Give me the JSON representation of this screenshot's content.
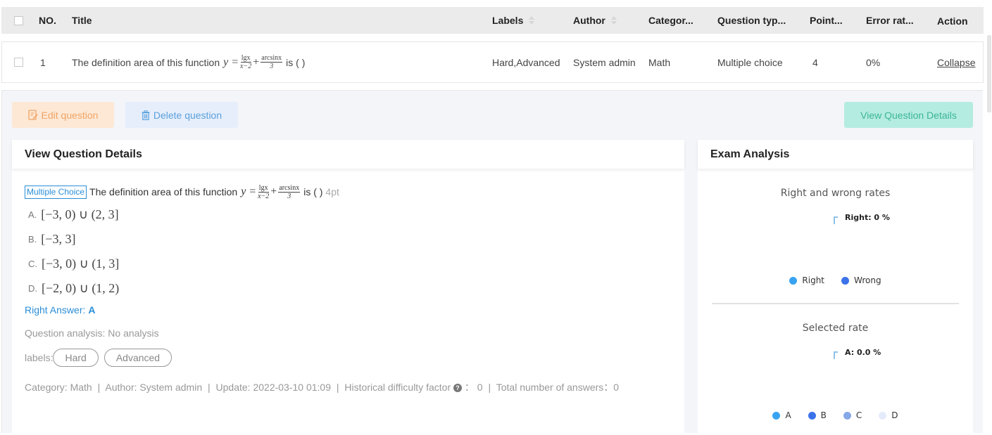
{
  "table": {
    "headers": {
      "no": "NO.",
      "title": "Title",
      "labels": "Labels",
      "author": "Author",
      "category": "Categor...",
      "question_type": "Question typ...",
      "points": "Point...",
      "error_rate": "Error rat...",
      "action": "Action"
    },
    "rows": [
      {
        "no": "1",
        "title_prefix": "The definition area of this function",
        "title_formula": {
          "lhs": "y =",
          "frac1_num": "lgx",
          "frac1_den": "x−2",
          "plus": "+",
          "frac2_num": "arcsinx",
          "frac2_den": "3"
        },
        "title_suffix": "is ( )",
        "labels": "Hard,Advanced",
        "author": "System admin",
        "category": "Math",
        "question_type": "Multiple choice",
        "points": "4",
        "error_rate": "0%",
        "action": "Collapse"
      }
    ]
  },
  "toolbar": {
    "edit_label": "Edit question",
    "delete_label": "Delete question",
    "view_label": "View Question Details"
  },
  "question_panel": {
    "heading": "View Question Details",
    "type_badge": "Multiple Choice",
    "question_prefix": "The definition area of this function",
    "question_suffix": "is ( )",
    "points": "4pt",
    "options": [
      {
        "letter": "A.",
        "value": "[−3, 0) ∪ (2, 3]"
      },
      {
        "letter": "B.",
        "value": "[−3, 3]"
      },
      {
        "letter": "C.",
        "value": "[−3, 0) ∪ (1, 3]"
      },
      {
        "letter": "D.",
        "value": "[−2, 0) ∪ (1, 2)"
      }
    ],
    "right_answer_label": "Right Answer:",
    "right_answer_value": "A",
    "analysis": "Question analysis: No analysis",
    "labels_caption": "labels:",
    "tags": [
      "Hard",
      "Advanced"
    ],
    "meta": {
      "category": "Category: Math",
      "author": "Author: System admin",
      "update": "Update: 2022-03-10 01:09",
      "difficulty_label": "Historical difficulty factor",
      "difficulty_value": "： 0",
      "total_answers": "Total number of answers：0",
      "separator": "|"
    }
  },
  "analysis_panel": {
    "heading": "Exam Analysis",
    "charts": [
      {
        "title": "Right and wrong rates",
        "tooltip": "Right: 0 %",
        "legend": [
          {
            "name": "Right",
            "color": "#38a3f1"
          },
          {
            "name": "Wrong",
            "color": "#3b72ea"
          }
        ]
      },
      {
        "title": "Selected rate",
        "tooltip": "A: 0.0 %",
        "legend": [
          {
            "name": "A",
            "color": "#38a3f1"
          },
          {
            "name": "B",
            "color": "#3b72ea"
          },
          {
            "name": "C",
            "color": "#86a8e7"
          },
          {
            "name": "D",
            "color": "#e4ebfb"
          }
        ]
      }
    ]
  },
  "colors": {
    "accent": "#2a8ed8",
    "link": "#3a8fd6",
    "edit_bg": "#fde8d5",
    "delete_bg": "#e6eefc",
    "view_bg": "#b5ece2"
  }
}
